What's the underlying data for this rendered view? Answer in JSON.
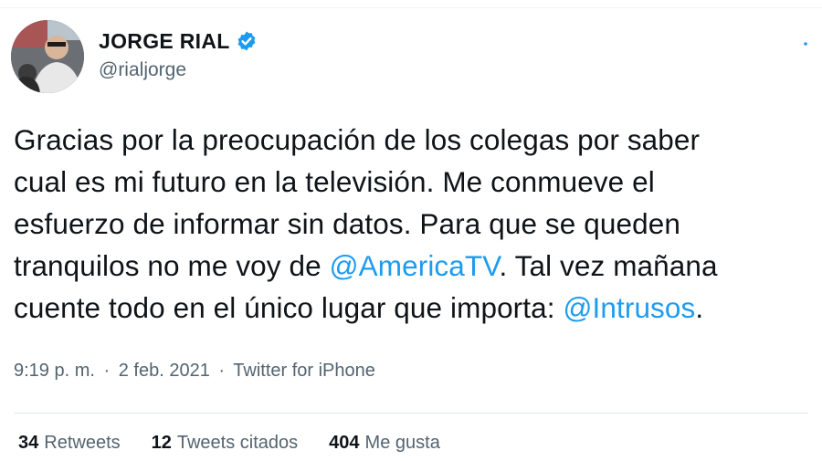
{
  "author": {
    "display_name": "JORGE RIAL",
    "handle": "@rialjorge",
    "verified": true
  },
  "tweet": {
    "lines": [
      {
        "before": "Gracias por la preocupación de los colegas por saber",
        "mention": "",
        "after": ""
      },
      {
        "before": "cual es mi futuro en la televisión. Me conmueve el",
        "mention": "",
        "after": ""
      },
      {
        "before": "esfuerzo de informar sin datos. Para que se queden",
        "mention": "",
        "after": ""
      },
      {
        "before": "tranquilos no me voy de ",
        "mention": "@AmericaTV",
        "after": ". Tal vez mañana"
      },
      {
        "before": "cuente todo en el único lugar que importa: ",
        "mention": "@Intrusos",
        "after": "."
      }
    ]
  },
  "meta": {
    "time": "9:19 p. m.",
    "separator": "·",
    "date": "2 feb. 2021",
    "source": "Twitter for iPhone"
  },
  "stats": {
    "retweets": {
      "count": "34",
      "label": "Retweets"
    },
    "quotes": {
      "count": "12",
      "label": "Tweets citados"
    },
    "likes": {
      "count": "404",
      "label": "Me gusta"
    }
  },
  "colors": {
    "accent": "#1d9bf0",
    "text": "#0f1419",
    "secondary": "#536471"
  },
  "icons": {
    "verified": "verified-badge-icon",
    "more": "more-options-icon"
  }
}
